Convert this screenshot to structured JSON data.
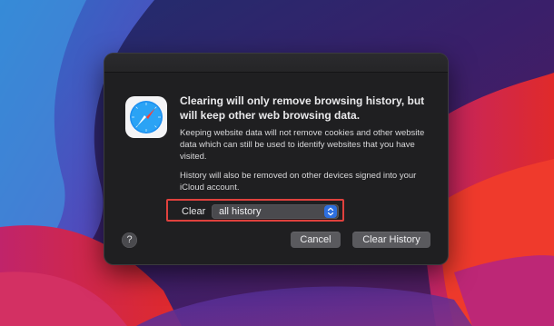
{
  "dialog": {
    "headline": "Clearing will only remove browsing history, but will keep other web browsing data.",
    "body_1": "Keeping website data will not remove cookies and other website data which can still be used to identify websites that you have visited.",
    "body_2": "History will also be removed on other devices signed into your iCloud account.",
    "clear_label": "Clear",
    "clear_select": {
      "value": "all history"
    },
    "help_label": "?",
    "buttons": {
      "cancel": "Cancel",
      "clear_history": "Clear History"
    },
    "app_icon": "safari-compass-icon"
  },
  "colors": {
    "highlight_box": "#e0413d",
    "stepper_accent": "#2d6fe0"
  }
}
